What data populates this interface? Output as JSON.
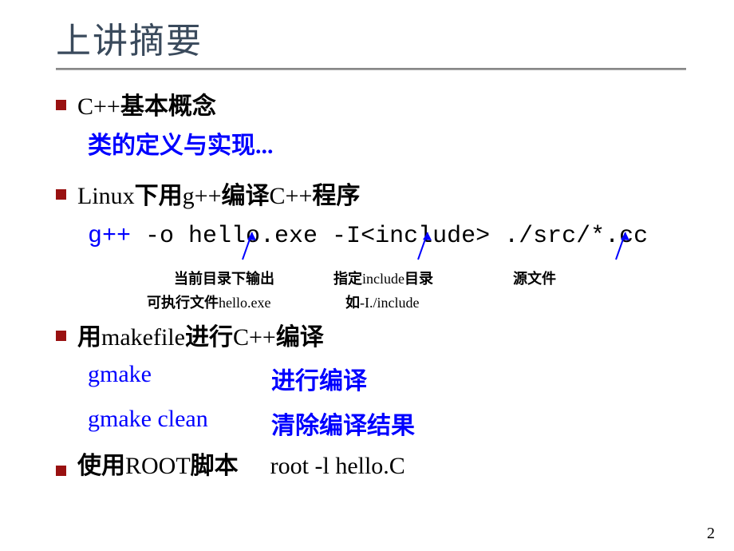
{
  "title": "上讲摘要",
  "items": {
    "b1_prefix": "C++",
    "b1_suffix": "基本概念",
    "sub1": "类的定义与实现...",
    "b2_prefix_roman": "Linux",
    "b2_mid1": "下用",
    "b2_gpp": "g++",
    "b2_mid2": "编译",
    "b2_cpp": "C++",
    "b2_suffix": "程序",
    "code_blue": "g++",
    "code_rest": " -o hello.exe -I<include>  ./src/*.cc",
    "ann1": "当前目录下输出",
    "ann2_prefix": "指定",
    "ann2_roman": "include",
    "ann2_suffix": "目录",
    "ann3": "源文件",
    "ann1b_prefix": "可执行文件",
    "ann1b_roman": "hello.exe",
    "ann2b_prefix": "如",
    "ann2b_roman": "-I./include",
    "b3_prefix": "用",
    "b3_roman": "makefile",
    "b3_mid": "进行",
    "b3_cpp": "C++",
    "b3_suffix": "编译",
    "gmake": "gmake",
    "gmake_desc": "进行编译",
    "gmake_clean": "gmake clean",
    "gmake_clean_desc": "清除编译结果",
    "b4_prefix": "使用",
    "b4_roman": "ROOT",
    "b4_suffix": "脚本",
    "b4_cmd": "root -l hello.C"
  },
  "page": "2"
}
